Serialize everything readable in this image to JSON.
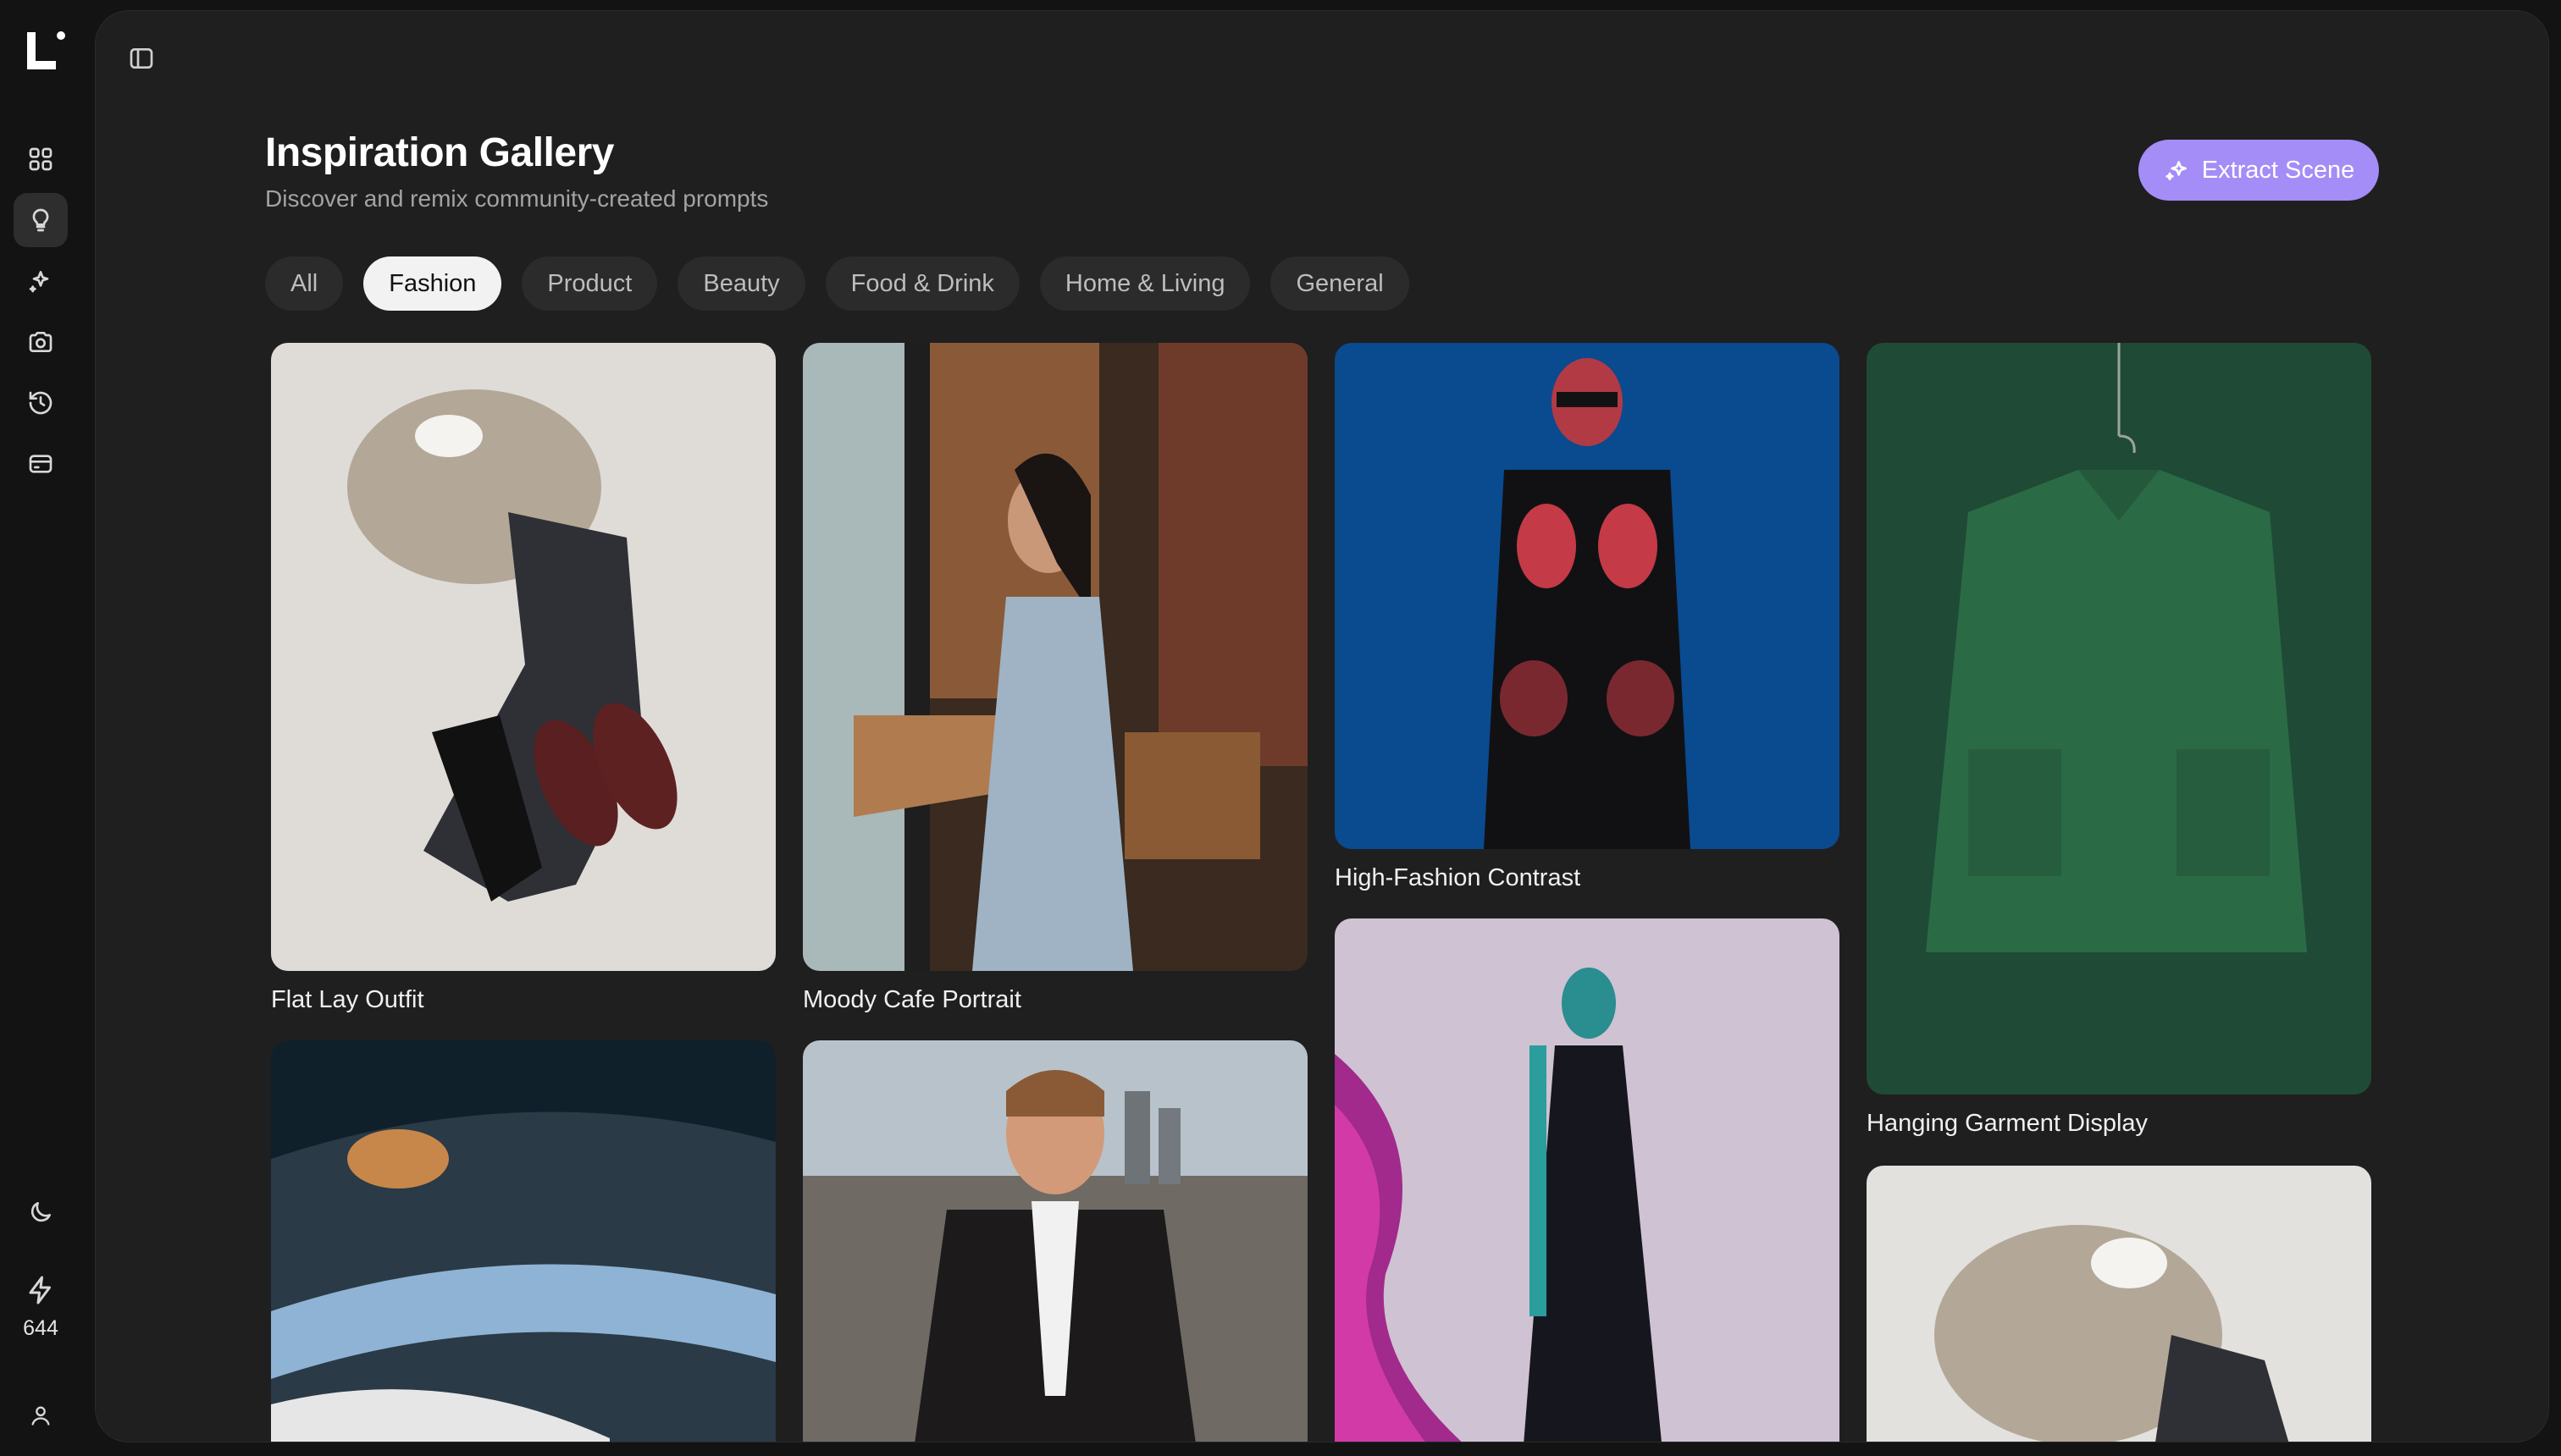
{
  "sidebar": {
    "items": [
      {
        "name": "dashboard",
        "icon": "grid-icon"
      },
      {
        "name": "inspiration",
        "icon": "lightbulb-icon",
        "active": true
      },
      {
        "name": "generate",
        "icon": "sparkle-icon"
      },
      {
        "name": "photo",
        "icon": "camera-icon"
      },
      {
        "name": "history",
        "icon": "history-icon"
      },
      {
        "name": "billing",
        "icon": "credit-card-icon"
      }
    ],
    "bottom": {
      "theme_icon": "moon-icon",
      "credits_icon": "lightning-icon",
      "credits": "644",
      "account_icon": "user-icon"
    }
  },
  "header": {
    "title": "Inspiration Gallery",
    "subtitle": "Discover and remix community-created prompts",
    "action_label": "Extract Scene"
  },
  "tabs": [
    {
      "label": "All",
      "active": false
    },
    {
      "label": "Fashion",
      "active": true
    },
    {
      "label": "Product",
      "active": false
    },
    {
      "label": "Beauty",
      "active": false
    },
    {
      "label": "Food & Drink",
      "active": false
    },
    {
      "label": "Home & Living",
      "active": false
    },
    {
      "label": "General",
      "active": false
    }
  ],
  "gallery": [
    {
      "title": "Flat Lay Outfit"
    },
    {
      "title": "Moody Cafe Portrait"
    },
    {
      "title": "High-Fashion Contrast"
    },
    {
      "title": "Hanging Garment Display"
    }
  ],
  "colors": {
    "accent": "#a48df7",
    "panel": "#1f1f1f",
    "background": "#131313"
  }
}
